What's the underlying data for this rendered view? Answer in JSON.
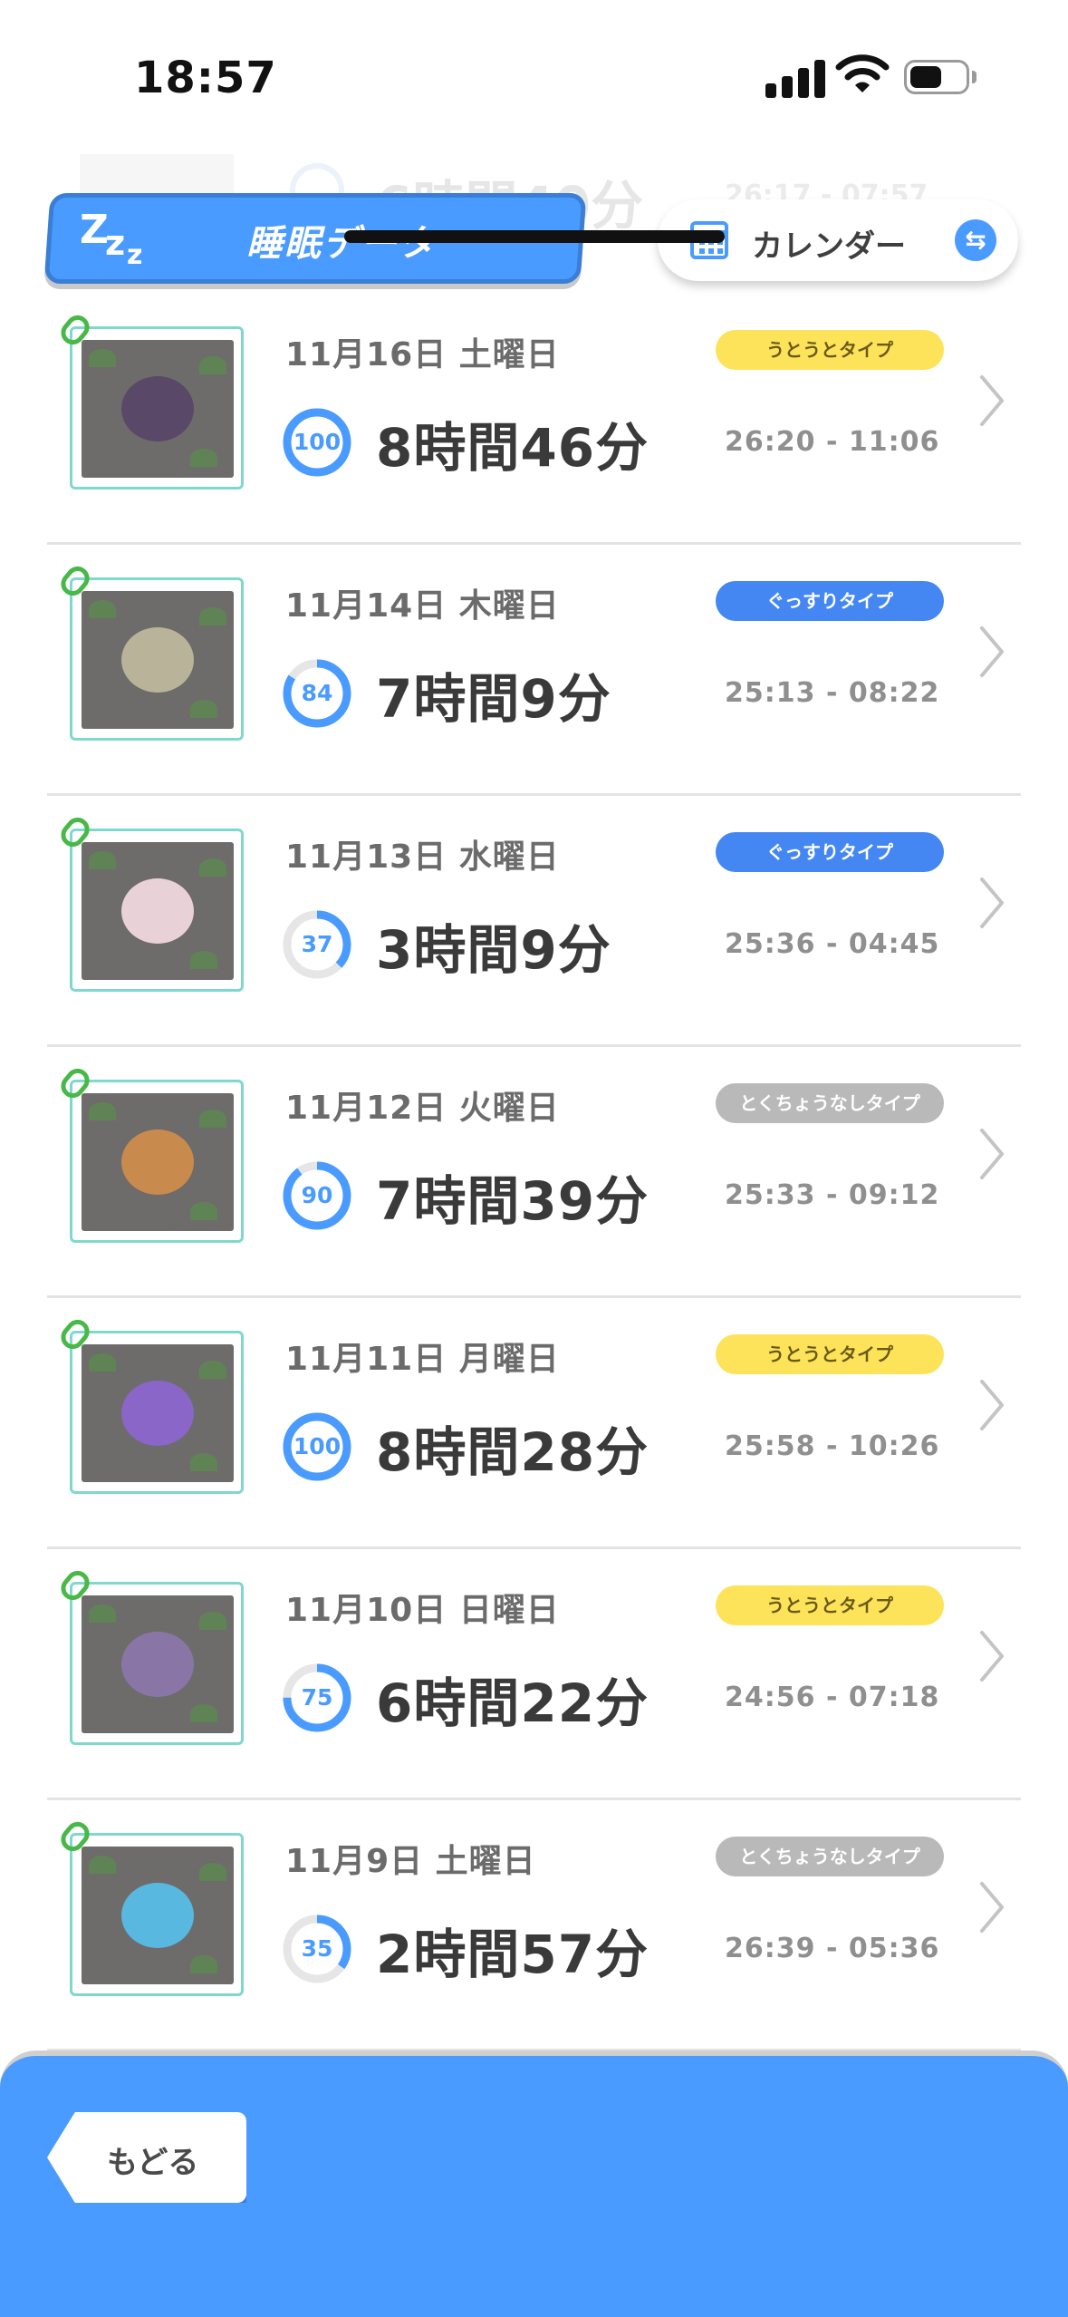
{
  "status_bar": {
    "time": "18:57"
  },
  "peek_row": {
    "score": "92",
    "duration": "6時間40分",
    "time_range": "26:17 - 07:57"
  },
  "header": {
    "title": "睡眠データ",
    "calendar_label": "カレンダー"
  },
  "records": [
    {
      "date": "11月16日 土曜日",
      "score": 100,
      "score_label": "100",
      "duration": "8時間46分",
      "type": "うとうとタイプ",
      "type_color": "yellow",
      "time_range": "26:20 - 11:06",
      "creature_color": "#5a4868"
    },
    {
      "date": "11月14日 木曜日",
      "score": 84,
      "score_label": "84",
      "duration": "7時間9分",
      "type": "ぐっすりタイプ",
      "type_color": "blue",
      "time_range": "25:13 - 08:22",
      "creature_color": "#b9b39a"
    },
    {
      "date": "11月13日 水曜日",
      "score": 37,
      "score_label": "37",
      "duration": "3時間9分",
      "type": "ぐっすりタイプ",
      "type_color": "blue",
      "time_range": "25:36 - 04:45",
      "creature_color": "#e8d2d8"
    },
    {
      "date": "11月12日 火曜日",
      "score": 90,
      "score_label": "90",
      "duration": "7時間39分",
      "type": "とくちょうなしタイプ",
      "type_color": "gray",
      "time_range": "25:33 - 09:12",
      "creature_color": "#c98a4e"
    },
    {
      "date": "11月11日 月曜日",
      "score": 100,
      "score_label": "100",
      "duration": "8時間28分",
      "type": "うとうとタイプ",
      "type_color": "yellow",
      "time_range": "25:58 - 10:26",
      "creature_color": "#8a66c9"
    },
    {
      "date": "11月10日 日曜日",
      "score": 75,
      "score_label": "75",
      "duration": "6時間22分",
      "type": "うとうとタイプ",
      "type_color": "yellow",
      "time_range": "24:56 - 07:18",
      "creature_color": "#8a76a6"
    },
    {
      "date": "11月9日 土曜日",
      "score": 35,
      "score_label": "35",
      "duration": "2時間57分",
      "type": "とくちょうなしタイプ",
      "type_color": "gray",
      "time_range": "26:39 - 05:36",
      "creature_color": "#58b8e0"
    }
  ],
  "bottom": {
    "back_label": "もどる"
  },
  "colors": {
    "accent": "#4a9bff",
    "ring_track": "#e6e6e6",
    "badge_yellow": "#fde35a",
    "badge_blue": "#4587f2",
    "badge_gray": "#b9b9b9"
  }
}
